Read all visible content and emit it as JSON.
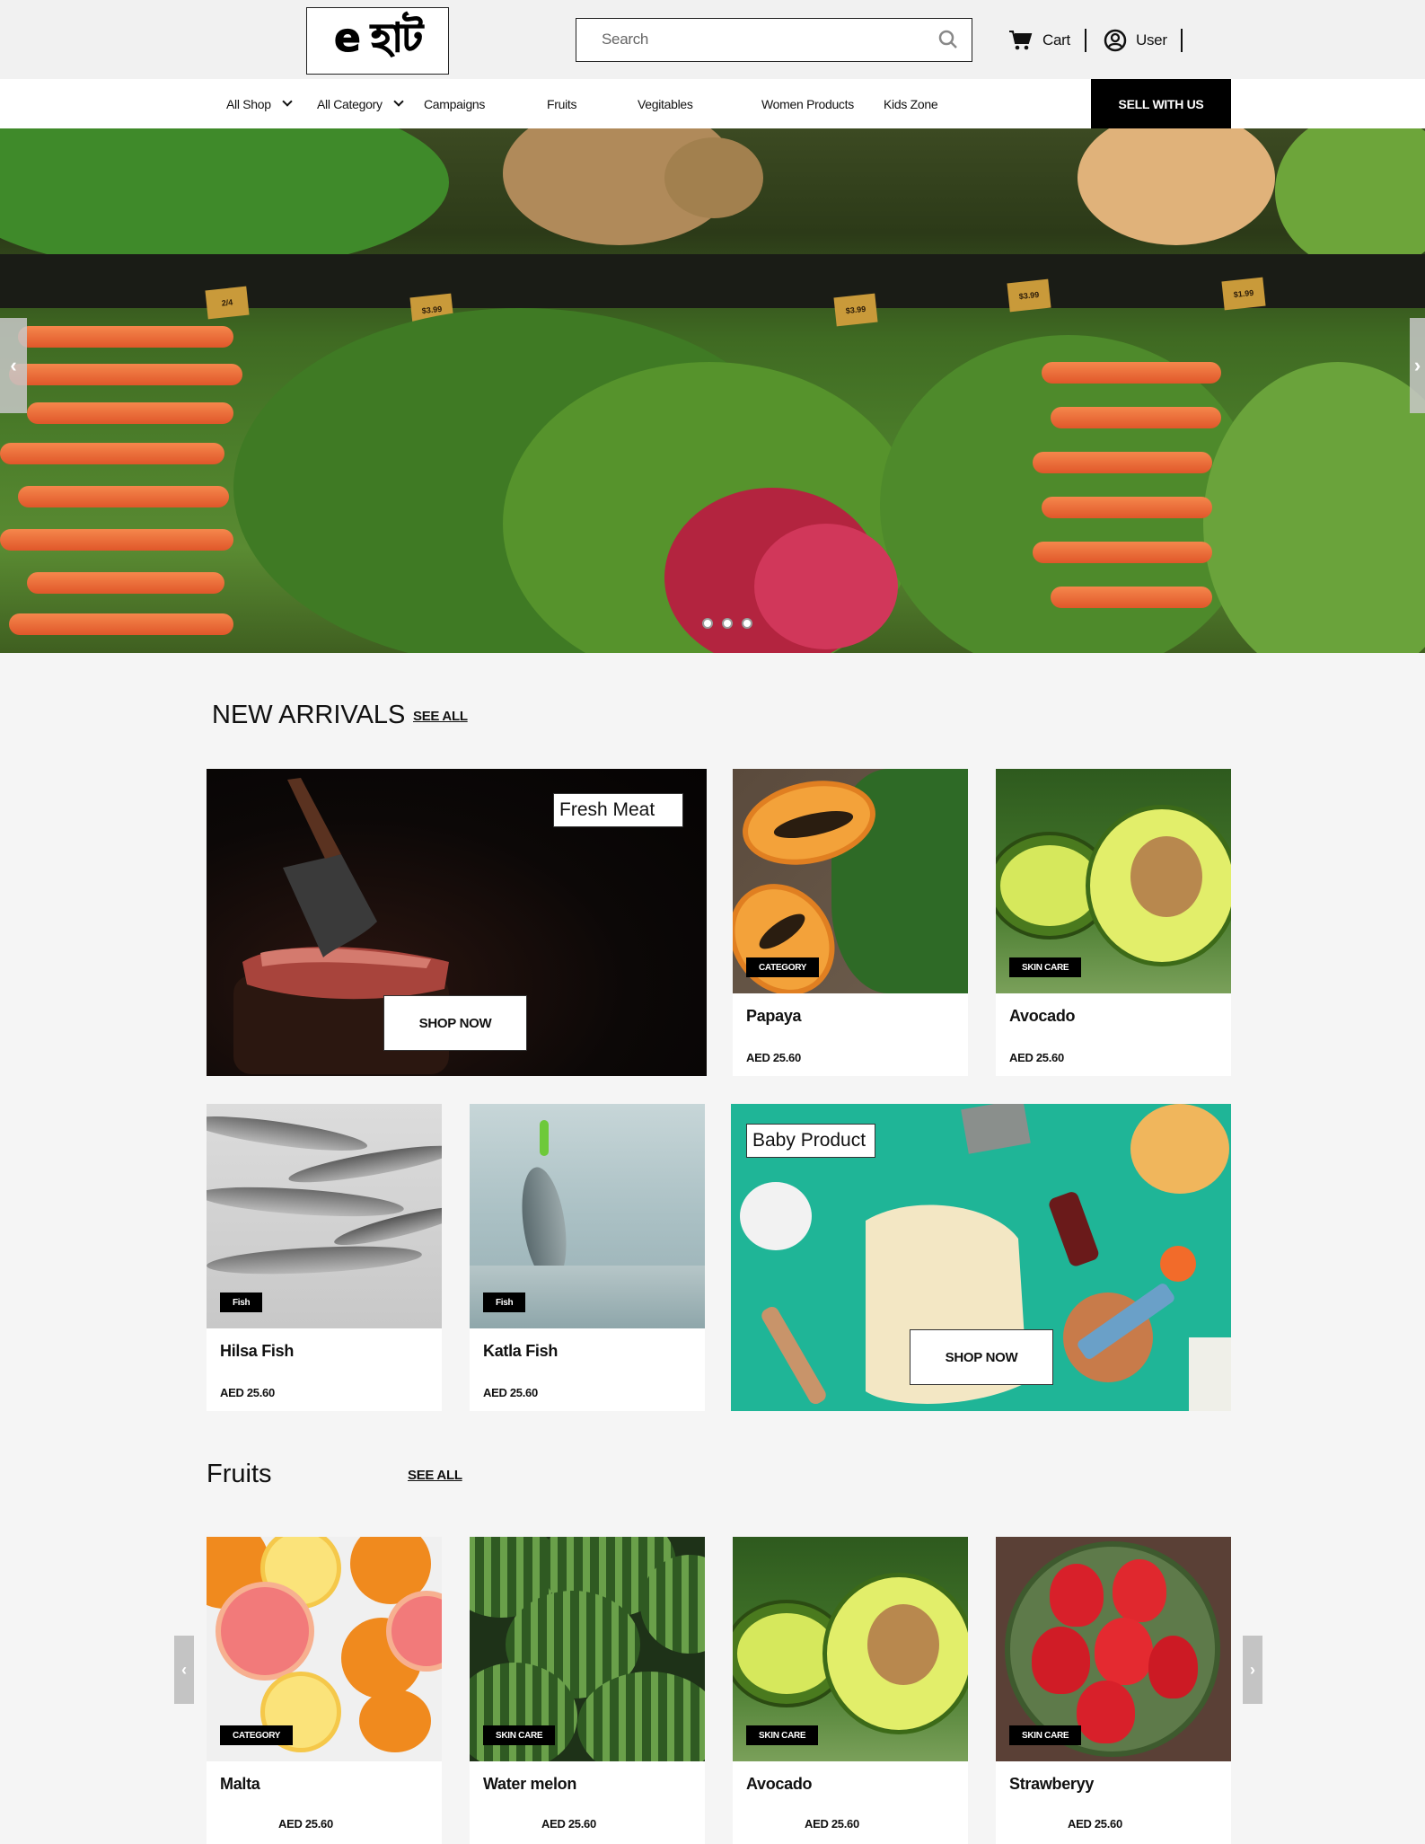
{
  "header": {
    "logo_text": "e হাট",
    "search_placeholder": "Search",
    "cart_label": "Cart",
    "user_label": "User"
  },
  "nav": {
    "items": [
      "All Shop",
      "All Category",
      "Campaigns",
      "Fruits",
      "Vegitables",
      "Women Products",
      "Kids Zone"
    ],
    "sell_label": "SELL WITH US"
  },
  "hero": {
    "prev_label": "‹",
    "next_label": "›",
    "slide_count": 3,
    "price_tags": [
      "2/4",
      "$3.99",
      "$3.99",
      "$3.99",
      "$1.99",
      "$1.99"
    ]
  },
  "new_arrivals": {
    "title": "NEW ARRIVALS",
    "see_all": "SEE ALL",
    "promo_meat": {
      "label": "Fresh Meat",
      "button": "SHOP NOW"
    },
    "promo_baby": {
      "label": "Baby Product",
      "button": "SHOP NOW"
    },
    "products": [
      {
        "name": "Papaya",
        "badge": "CATEGORY",
        "price": "AED 25.60"
      },
      {
        "name": "Avocado",
        "badge": "SKIN CARE",
        "price": "AED 25.60"
      },
      {
        "name": "Hilsa Fish",
        "badge": "Fish",
        "price": "AED 25.60"
      },
      {
        "name": "Katla Fish",
        "badge": "Fish",
        "price": "AED 25.60"
      }
    ]
  },
  "fruits": {
    "title": "Fruits",
    "see_all": "SEE ALL",
    "prev_label": "‹",
    "next_label": "›",
    "products": [
      {
        "name": "Malta",
        "badge": "CATEGORY",
        "price": "AED 25.60"
      },
      {
        "name": "Water melon",
        "badge": "SKIN CARE",
        "price": "AED 25.60"
      },
      {
        "name": "Avocado",
        "badge": "SKIN CARE",
        "price": "AED 25.60"
      },
      {
        "name": "Strawberyy",
        "badge": "SKIN CARE",
        "price": "AED 25.60"
      }
    ]
  }
}
